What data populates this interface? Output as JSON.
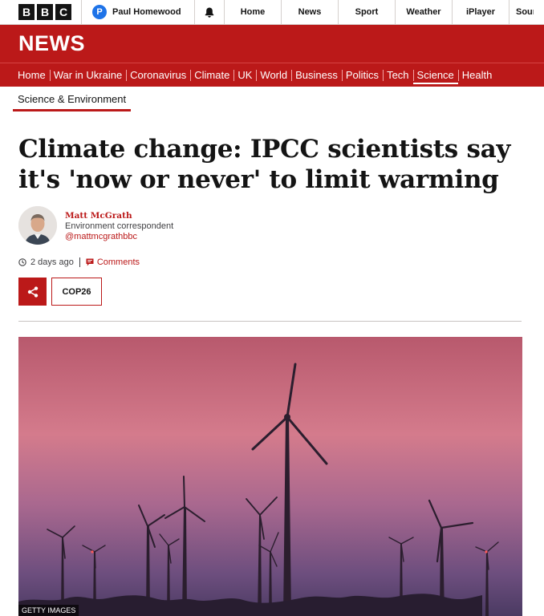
{
  "global_nav": {
    "logo": [
      "B",
      "B",
      "C"
    ],
    "account_initial": "P",
    "account_name": "Paul Homewood",
    "items": [
      "Home",
      "News",
      "Sport",
      "Weather",
      "iPlayer",
      "Sour"
    ]
  },
  "masthead": {
    "title": "NEWS"
  },
  "news_nav": {
    "items": [
      "Home",
      "War in Ukraine",
      "Coronavirus",
      "Climate",
      "UK",
      "World",
      "Business",
      "Politics",
      "Tech",
      "Science",
      "Health"
    ],
    "active": "Science"
  },
  "section": {
    "label": "Science & Environment"
  },
  "article": {
    "headline": "Climate change: IPCC scientists say it's 'now or never' to limit warming",
    "author": {
      "name": "Matt McGrath",
      "role": "Environment correspondent",
      "handle": "@mattmcgrathbbc"
    },
    "timestamp": "2 days ago",
    "comments_label": "Comments",
    "topic_tag": "COP26",
    "image_credit": "GETTY IMAGES"
  },
  "colors": {
    "brand_red": "#bb1919",
    "account_blue": "#1e73e8"
  },
  "icons": {
    "notifications": "bell-icon",
    "clock": "clock-icon",
    "comments": "speech-bubble-icon",
    "share": "share-icon"
  }
}
